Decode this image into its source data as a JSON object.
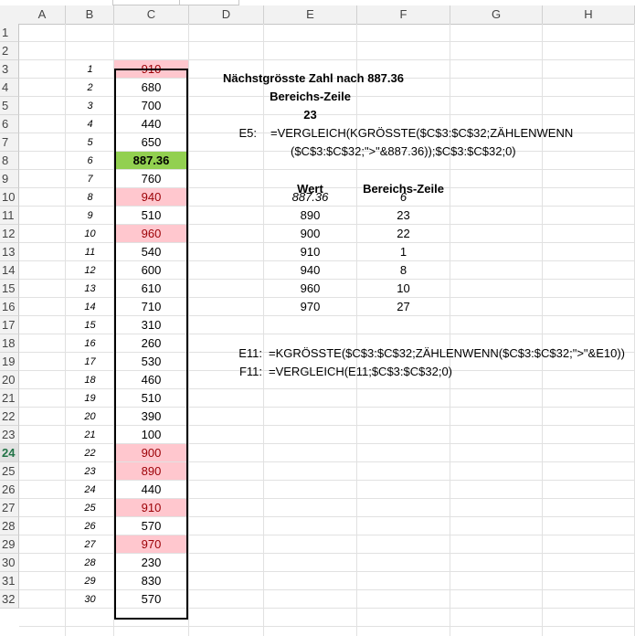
{
  "columns": [
    "A",
    "B",
    "C",
    "D",
    "E",
    "F",
    "G",
    "H"
  ],
  "rows": [
    "1",
    "2",
    "3",
    "4",
    "5",
    "6",
    "7",
    "8",
    "9",
    "10",
    "11",
    "12",
    "13",
    "14",
    "15",
    "16",
    "17",
    "18",
    "19",
    "20",
    "21",
    "22",
    "23",
    "24",
    "25",
    "26",
    "27",
    "28",
    "29",
    "30",
    "31",
    "32"
  ],
  "active_row": "24",
  "col_b": [
    "1",
    "2",
    "3",
    "4",
    "5",
    "6",
    "7",
    "8",
    "9",
    "10",
    "11",
    "12",
    "13",
    "14",
    "15",
    "16",
    "17",
    "18",
    "19",
    "20",
    "21",
    "22",
    "23",
    "24",
    "25",
    "26",
    "27",
    "28",
    "29",
    "30"
  ],
  "col_c": [
    "910",
    "680",
    "700",
    "440",
    "650",
    "887.36",
    "760",
    "940",
    "510",
    "960",
    "540",
    "600",
    "610",
    "710",
    "310",
    "260",
    "530",
    "460",
    "510",
    "390",
    "100",
    "900",
    "890",
    "440",
    "910",
    "570",
    "970",
    "230",
    "830",
    "570"
  ],
  "col_c_style": [
    "pink",
    "",
    "",
    "",
    "",
    "green",
    "",
    "pink",
    "",
    "pink",
    "",
    "",
    "",
    "",
    "",
    "",
    "",
    "",
    "",
    "",
    "",
    "pink",
    "pink",
    "",
    "pink",
    "",
    "pink",
    "",
    "",
    ""
  ],
  "title": "Nächstgrösste Zahl nach 887.36",
  "label_bereichs_zeile": "Bereichs-Zeile",
  "result_e5": "23",
  "label_e5": "E5:",
  "formula_e5_line1": "=VERGLEICH(KGRÖSSTE($C$3:$C$32;ZÄHLENWENN",
  "formula_e5_line2": "($C$3:$C$32;\">\"&887.36));$C$3:$C$32;0)",
  "table_header_wert": "Wert",
  "table_header_zeile": "Bereichs-Zeile",
  "table_rows": [
    {
      "wert": "887.36",
      "zeile": "6"
    },
    {
      "wert": "890",
      "zeile": "23"
    },
    {
      "wert": "900",
      "zeile": "22"
    },
    {
      "wert": "910",
      "zeile": "1"
    },
    {
      "wert": "940",
      "zeile": "8"
    },
    {
      "wert": "960",
      "zeile": "10"
    },
    {
      "wert": "970",
      "zeile": "27"
    }
  ],
  "label_e11": "E11:",
  "formula_e11": "=KGRÖSSTE($C$3:$C$32;ZÄHLENWENN($C$3:$C$32;\">\"&E10))",
  "label_f11": "F11:",
  "formula_f11": "=VERGLEICH(E11;$C$3:$C$32;0)",
  "colors": {
    "pink_fill": "#ffc7ce",
    "pink_text": "#9c0006",
    "green_fill": "#92d050",
    "header_green": "#217346"
  }
}
